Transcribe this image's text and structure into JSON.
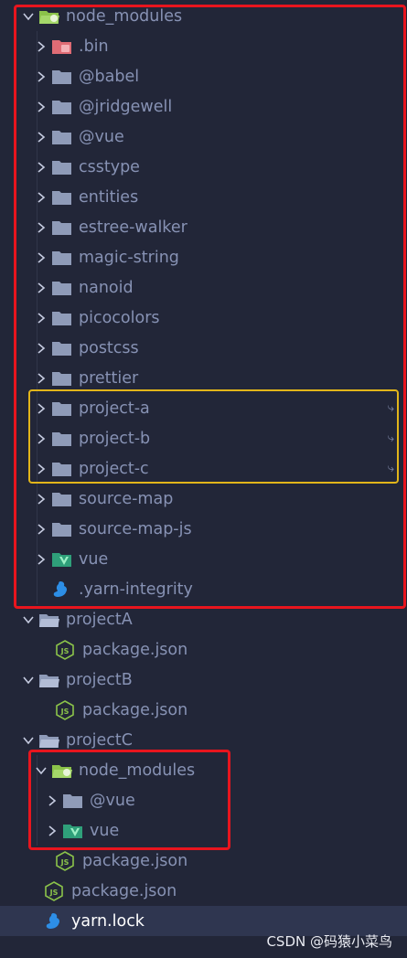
{
  "tree": {
    "rows": [
      {
        "label": "node_modules"
      },
      {
        "label": ".bin"
      },
      {
        "label": "@babel"
      },
      {
        "label": "@jridgewell"
      },
      {
        "label": "@vue"
      },
      {
        "label": "csstype"
      },
      {
        "label": "entities"
      },
      {
        "label": "estree-walker"
      },
      {
        "label": "magic-string"
      },
      {
        "label": "nanoid"
      },
      {
        "label": "picocolors"
      },
      {
        "label": "postcss"
      },
      {
        "label": "prettier"
      },
      {
        "label": "project-a",
        "link": "⤷"
      },
      {
        "label": "project-b",
        "link": "⤷"
      },
      {
        "label": "project-c",
        "link": "⤷"
      },
      {
        "label": "source-map"
      },
      {
        "label": "source-map-js"
      },
      {
        "label": "vue"
      },
      {
        "label": ".yarn-integrity"
      },
      {
        "label": "projectA"
      },
      {
        "label": "package.json"
      },
      {
        "label": "projectB"
      },
      {
        "label": "package.json"
      },
      {
        "label": "projectC"
      },
      {
        "label": "node_modules"
      },
      {
        "label": "@vue"
      },
      {
        "label": "vue"
      },
      {
        "label": "package.json"
      },
      {
        "label": "package.json"
      },
      {
        "label": "yarn.lock"
      }
    ]
  },
  "watermark": "CSDN @码猿小菜鸟",
  "colors": {
    "background": "#222638",
    "selected_row": "#2f3650",
    "folder": "#8f9bb8",
    "node_folder": "#8bc34a",
    "vue_folder": "#41b883",
    "bin_folder": "#e06c75",
    "js_icon": "#8bc34a",
    "yarn_icon": "#2d8ee6",
    "highlight_red": "#e8151e",
    "highlight_yellow": "#e2b51a"
  }
}
